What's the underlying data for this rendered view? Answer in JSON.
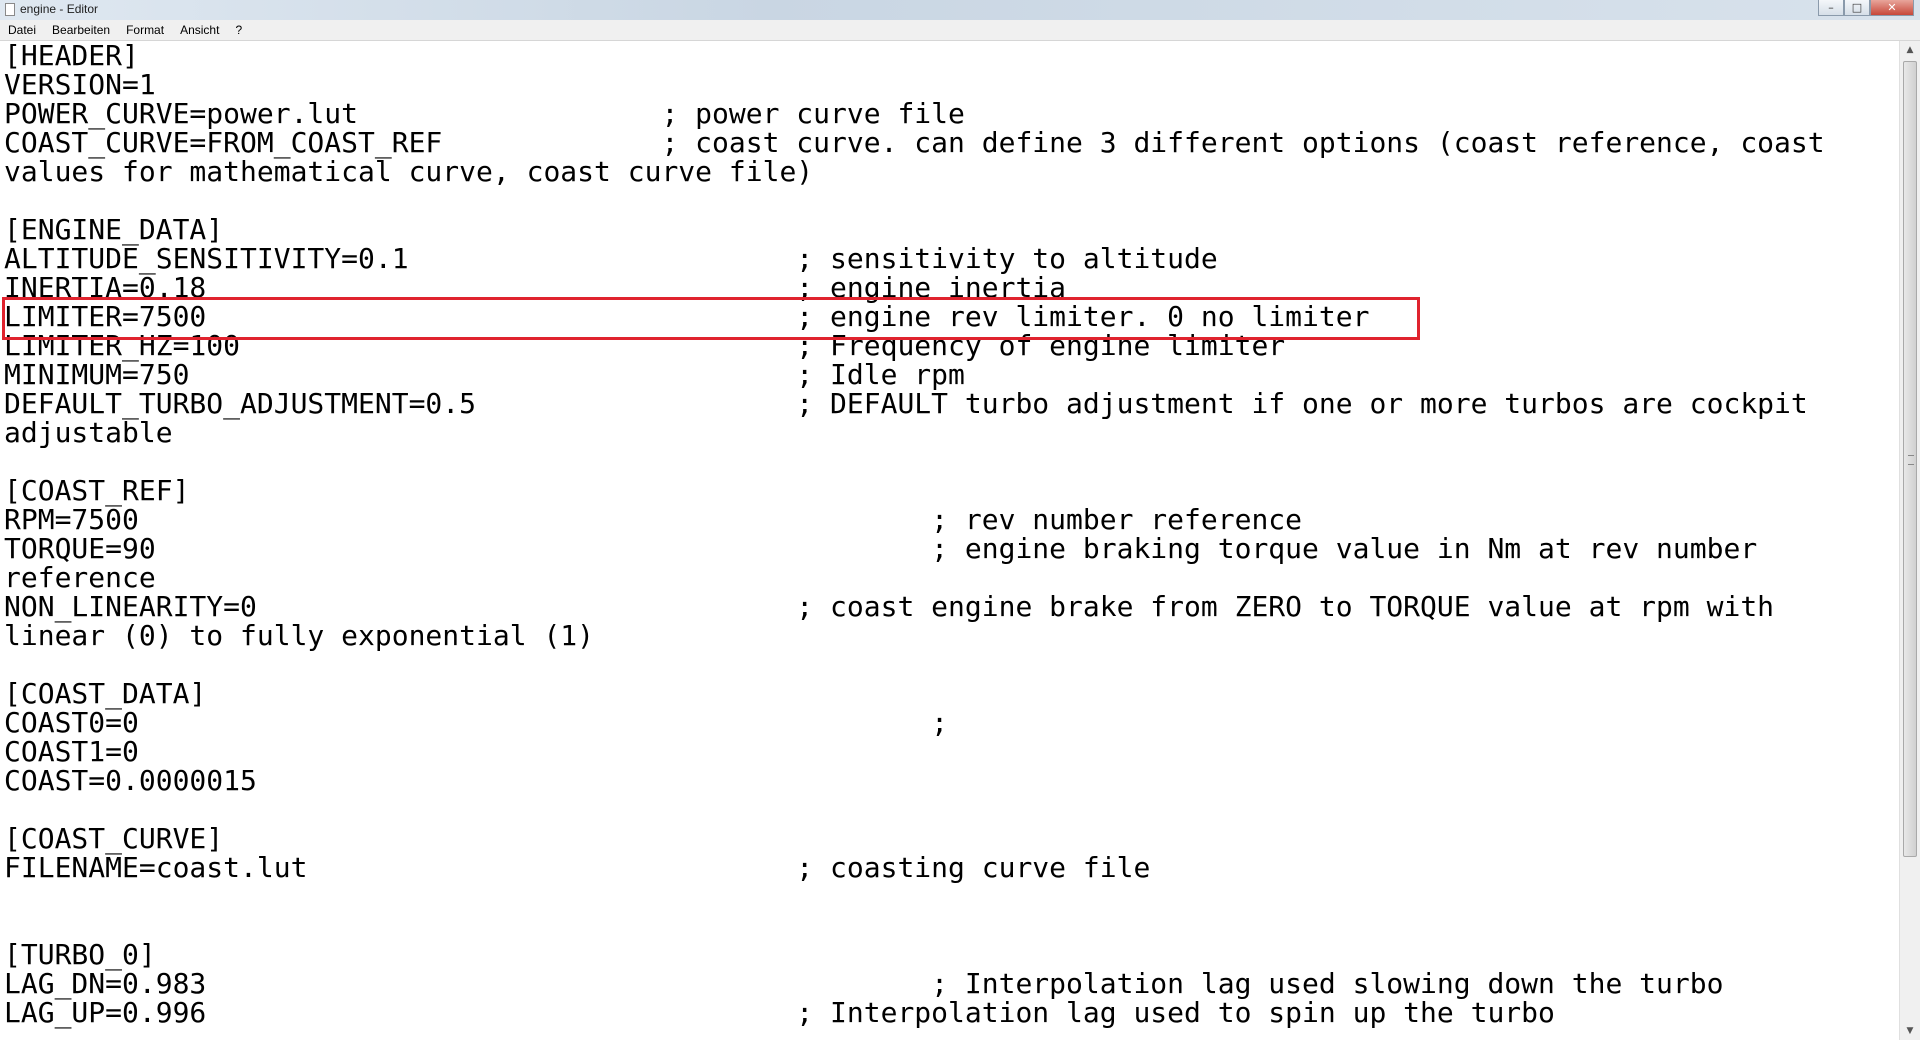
{
  "window": {
    "title": "engine - Editor",
    "min_glyph": "–",
    "max_glyph": "□",
    "close_glyph": "✕"
  },
  "menu": {
    "items": [
      "Datei",
      "Bearbeiten",
      "Format",
      "Ansicht",
      "?"
    ]
  },
  "editor": {
    "lines": [
      "[HEADER]",
      "VERSION=1",
      "POWER_CURVE=power.lut                  ; power curve file",
      "COAST_CURVE=FROM_COAST_REF             ; coast curve. can define 3 different options (coast reference, coast",
      "values for mathematical curve, coast curve file)",
      "",
      "[ENGINE_DATA]",
      "ALTITUDE_SENSITIVITY=0.1                       ; sensitivity to altitude",
      "INERTIA=0.18                                   ; engine inertia",
      "LIMITER=7500                                   ; engine rev limiter. 0 no limiter",
      "LIMITER_HZ=100                                 ; Frequency of engine limiter",
      "MINIMUM=750                                    ; Idle rpm",
      "DEFAULT_TURBO_ADJUSTMENT=0.5                   ; DEFAULT turbo adjustment if one or more turbos are cockpit",
      "adjustable",
      "",
      "[COAST_REF]",
      "RPM=7500                                               ; rev number reference",
      "TORQUE=90                                              ; engine braking torque value in Nm at rev number",
      "reference",
      "NON_LINEARITY=0                                ; coast engine brake from ZERO to TORQUE value at rpm with",
      "linear (0) to fully exponential (1)",
      "",
      "[COAST_DATA]",
      "COAST0=0                                               ;",
      "COAST1=0",
      "COAST=0.0000015",
      "",
      "[COAST_CURVE]",
      "FILENAME=coast.lut                             ; coasting curve file",
      "",
      "",
      "[TURBO_0]",
      "LAG_DN=0.983                                           ; Interpolation lag used slowing down the turbo",
      "LAG_UP=0.996                                   ; Interpolation lag used to spin up the turbo"
    ]
  },
  "highlight": {
    "line_text": "LIMITER=7500                                   ; engine rev limiter. 0 no limiter",
    "color": "#e0232e"
  },
  "scrollbar": {
    "up_glyph": "▲",
    "down_glyph": "▼"
  }
}
